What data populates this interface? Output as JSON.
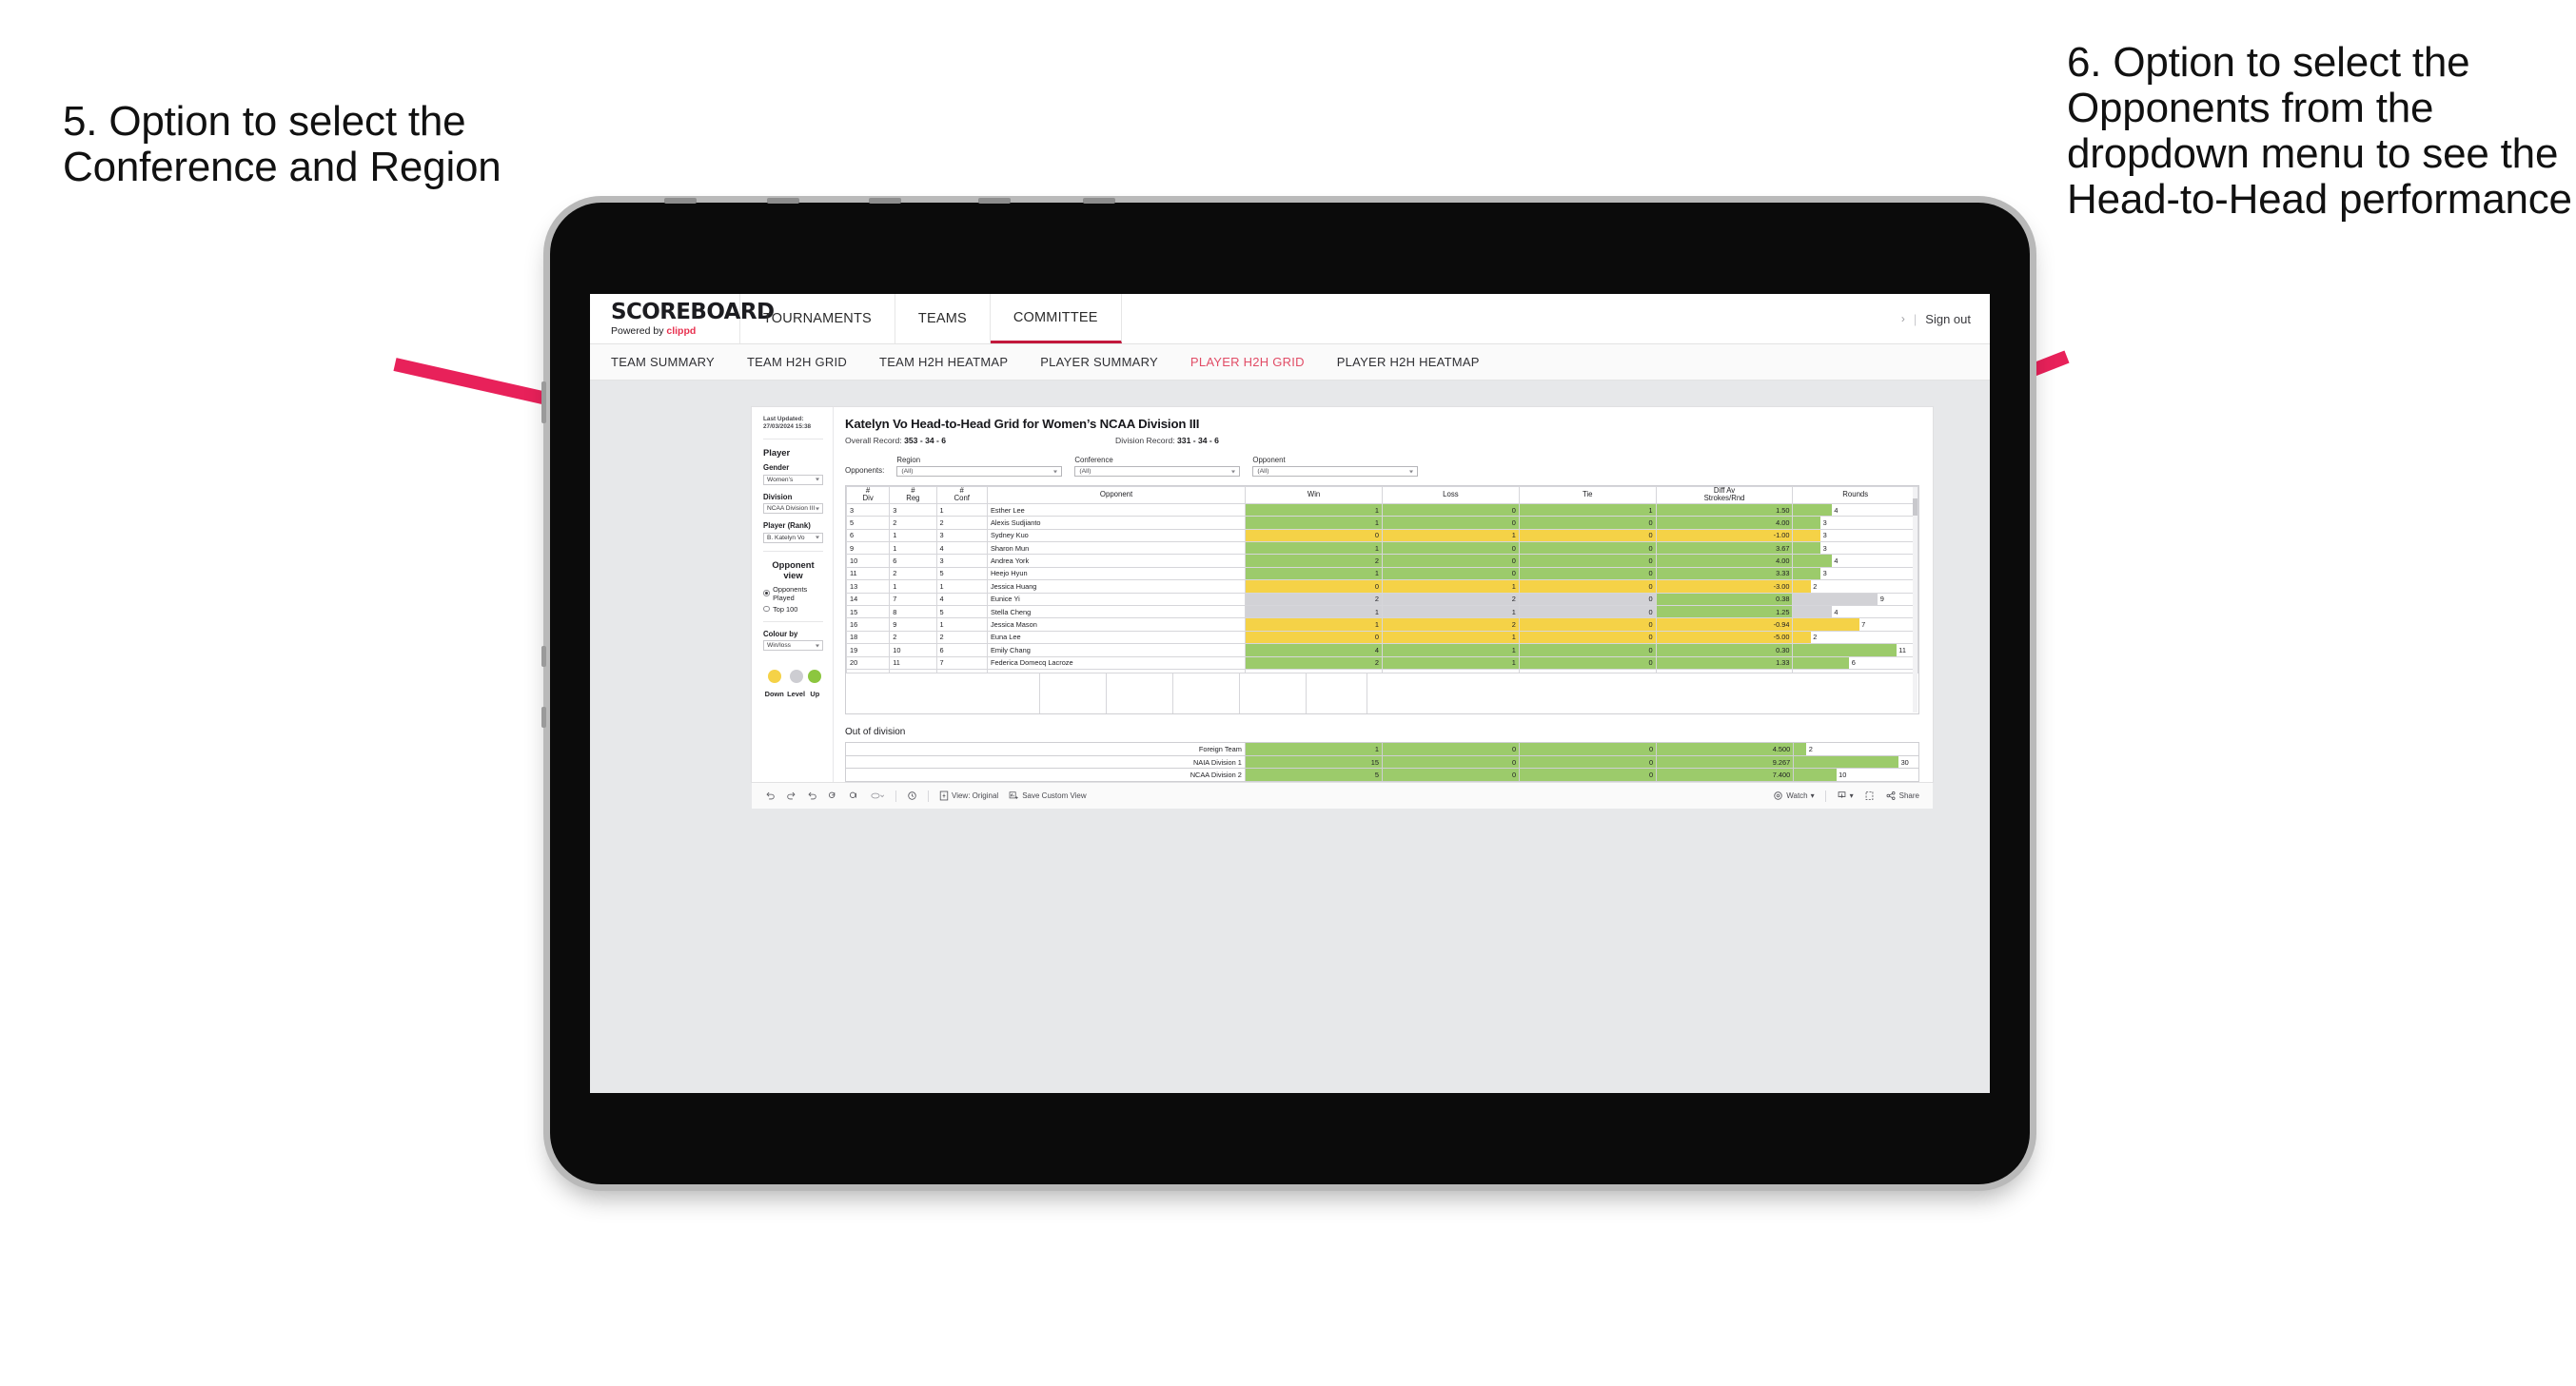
{
  "annotations": {
    "left": "5. Option to select the Conference and Region",
    "right": "6. Option to select the Opponents from the dropdown menu to see the Head-to-Head performance",
    "arrow_color": "#e8215a"
  },
  "app": {
    "brand": {
      "title": "SCOREBOARD",
      "powered_prefix": "Powered by",
      "powered_brand": "clippd"
    },
    "topnav": [
      {
        "label": "TOURNAMENTS",
        "active": false
      },
      {
        "label": "TEAMS",
        "active": false
      },
      {
        "label": "COMMITTEE",
        "active": true
      }
    ],
    "topbar_right": {
      "chevron": "›",
      "separator": "|",
      "sign_out": "Sign out"
    },
    "subnav": [
      {
        "label": "TEAM SUMMARY",
        "active": false
      },
      {
        "label": "TEAM H2H GRID",
        "active": false
      },
      {
        "label": "TEAM H2H HEATMAP",
        "active": false
      },
      {
        "label": "PLAYER SUMMARY",
        "active": false
      },
      {
        "label": "PLAYER H2H GRID",
        "active": true
      },
      {
        "label": "PLAYER H2H HEATMAP",
        "active": false
      }
    ]
  },
  "sidebar": {
    "last_updated": "Last Updated: 27/03/2024 15:38",
    "player_heading": "Player",
    "gender": {
      "label": "Gender",
      "value": "Women’s"
    },
    "division": {
      "label": "Division",
      "value": "NCAA Division III"
    },
    "player_rank": {
      "label": "Player (Rank)",
      "value": "B. Katelyn Vo"
    },
    "opponent_view": {
      "heading": "Opponent view",
      "options": [
        {
          "label": "Opponents Played",
          "selected": true
        },
        {
          "label": "Top 100",
          "selected": false
        }
      ]
    },
    "colour_by": {
      "label": "Colour by",
      "value": "Win/loss"
    },
    "legend": [
      {
        "caption": "Down",
        "color": "#f5d247"
      },
      {
        "caption": "Level",
        "color": "#cdcdd2"
      },
      {
        "caption": "Up",
        "color": "#8cc63f"
      }
    ]
  },
  "main": {
    "title": "Katelyn Vo Head-to-Head Grid for Women’s NCAA Division III",
    "overall_record_label": "Overall Record:",
    "overall_record_value": "353 - 34 - 6",
    "division_record_label": "Division Record:",
    "division_record_value": "331 -  34 - 6",
    "filters": {
      "row_label": "Opponents:",
      "region": {
        "label": "Region",
        "value": "(All)"
      },
      "conference": {
        "label": "Conference",
        "value": "(All)"
      },
      "opponent": {
        "label": "Opponent",
        "value": "(All)"
      }
    }
  },
  "grid": {
    "headers": {
      "div": [
        "#",
        "Div"
      ],
      "reg": [
        "#",
        "Reg"
      ],
      "conf": [
        "#",
        "Conf"
      ],
      "opponent": "Opponent",
      "win": "Win",
      "loss": "Loss",
      "tie": "Tie",
      "diff": [
        "Diff Av",
        "Strokes/Rnd"
      ],
      "rounds": "Rounds"
    },
    "rows": [
      {
        "div": "3",
        "reg": "3",
        "conf": "1",
        "opponent": "Esther Lee",
        "win": "1",
        "loss": "0",
        "tie": "1",
        "diff": "1.50",
        "rounds": "4",
        "tone": "green",
        "bar_pct": 31
      },
      {
        "div": "5",
        "reg": "2",
        "conf": "2",
        "opponent": "Alexis Sudjianto",
        "win": "1",
        "loss": "0",
        "tie": "0",
        "diff": "4.00",
        "rounds": "3",
        "tone": "green",
        "bar_pct": 22
      },
      {
        "div": "6",
        "reg": "1",
        "conf": "3",
        "opponent": "Sydney Kuo",
        "win": "0",
        "loss": "1",
        "tie": "0",
        "diff": "-1.00",
        "rounds": "3",
        "tone": "yellow",
        "bar_pct": 22
      },
      {
        "div": "9",
        "reg": "1",
        "conf": "4",
        "opponent": "Sharon Mun",
        "win": "1",
        "loss": "0",
        "tie": "0",
        "diff": "3.67",
        "rounds": "3",
        "tone": "green",
        "bar_pct": 22
      },
      {
        "div": "10",
        "reg": "6",
        "conf": "3",
        "opponent": "Andrea York",
        "win": "2",
        "loss": "0",
        "tie": "0",
        "diff": "4.00",
        "rounds": "4",
        "tone": "green",
        "bar_pct": 31
      },
      {
        "div": "11",
        "reg": "2",
        "conf": "5",
        "opponent": "Heejo Hyun",
        "win": "1",
        "loss": "0",
        "tie": "0",
        "diff": "3.33",
        "rounds": "3",
        "tone": "green",
        "bar_pct": 22
      },
      {
        "div": "13",
        "reg": "1",
        "conf": "1",
        "opponent": "Jessica Huang",
        "win": "0",
        "loss": "1",
        "tie": "0",
        "diff": "-3.00",
        "rounds": "2",
        "tone": "yellow",
        "bar_pct": 14
      },
      {
        "div": "14",
        "reg": "7",
        "conf": "4",
        "opponent": "Eunice Yi",
        "win": "2",
        "loss": "2",
        "tie": "0",
        "diff": "0.38",
        "rounds": "9",
        "tone": "grey",
        "bar_pct": 68,
        "diff_tone": "green"
      },
      {
        "div": "15",
        "reg": "8",
        "conf": "5",
        "opponent": "Stella Cheng",
        "win": "1",
        "loss": "1",
        "tie": "0",
        "diff": "1.25",
        "rounds": "4",
        "tone": "grey",
        "bar_pct": 31,
        "diff_tone": "green"
      },
      {
        "div": "16",
        "reg": "9",
        "conf": "1",
        "opponent": "Jessica Mason",
        "win": "1",
        "loss": "2",
        "tie": "0",
        "diff": "-0.94",
        "rounds": "7",
        "tone": "yellow",
        "bar_pct": 53
      },
      {
        "div": "18",
        "reg": "2",
        "conf": "2",
        "opponent": "Euna Lee",
        "win": "0",
        "loss": "1",
        "tie": "0",
        "diff": "-5.00",
        "rounds": "2",
        "tone": "yellow",
        "bar_pct": 14
      },
      {
        "div": "19",
        "reg": "10",
        "conf": "6",
        "opponent": "Emily Chang",
        "win": "4",
        "loss": "1",
        "tie": "0",
        "diff": "0.30",
        "rounds": "11",
        "tone": "green",
        "bar_pct": 83
      },
      {
        "div": "20",
        "reg": "11",
        "conf": "7",
        "opponent": "Federica Domecq Lacroze",
        "win": "2",
        "loss": "1",
        "tie": "0",
        "diff": "1.33",
        "rounds": "6",
        "tone": "green",
        "bar_pct": 45
      }
    ]
  },
  "out_of_division": {
    "heading": "Out of division",
    "rows": [
      {
        "label": "Foreign Team",
        "win": "1",
        "loss": "0",
        "tie": "0",
        "diff": "4.500",
        "rounds": "2",
        "tone": "green",
        "bar_pct": 10
      },
      {
        "label": "NAIA Division 1",
        "win": "15",
        "loss": "0",
        "tie": "0",
        "diff": "9.267",
        "rounds": "30",
        "tone": "green",
        "bar_pct": 84
      },
      {
        "label": "NCAA Division 2",
        "win": "5",
        "loss": "0",
        "tie": "0",
        "diff": "7.400",
        "rounds": "10",
        "tone": "green",
        "bar_pct": 34
      }
    ]
  },
  "toolbar": {
    "view_label": "View: Original",
    "save_custom_view": "Save Custom View",
    "watch": "Watch",
    "share": "Share"
  }
}
